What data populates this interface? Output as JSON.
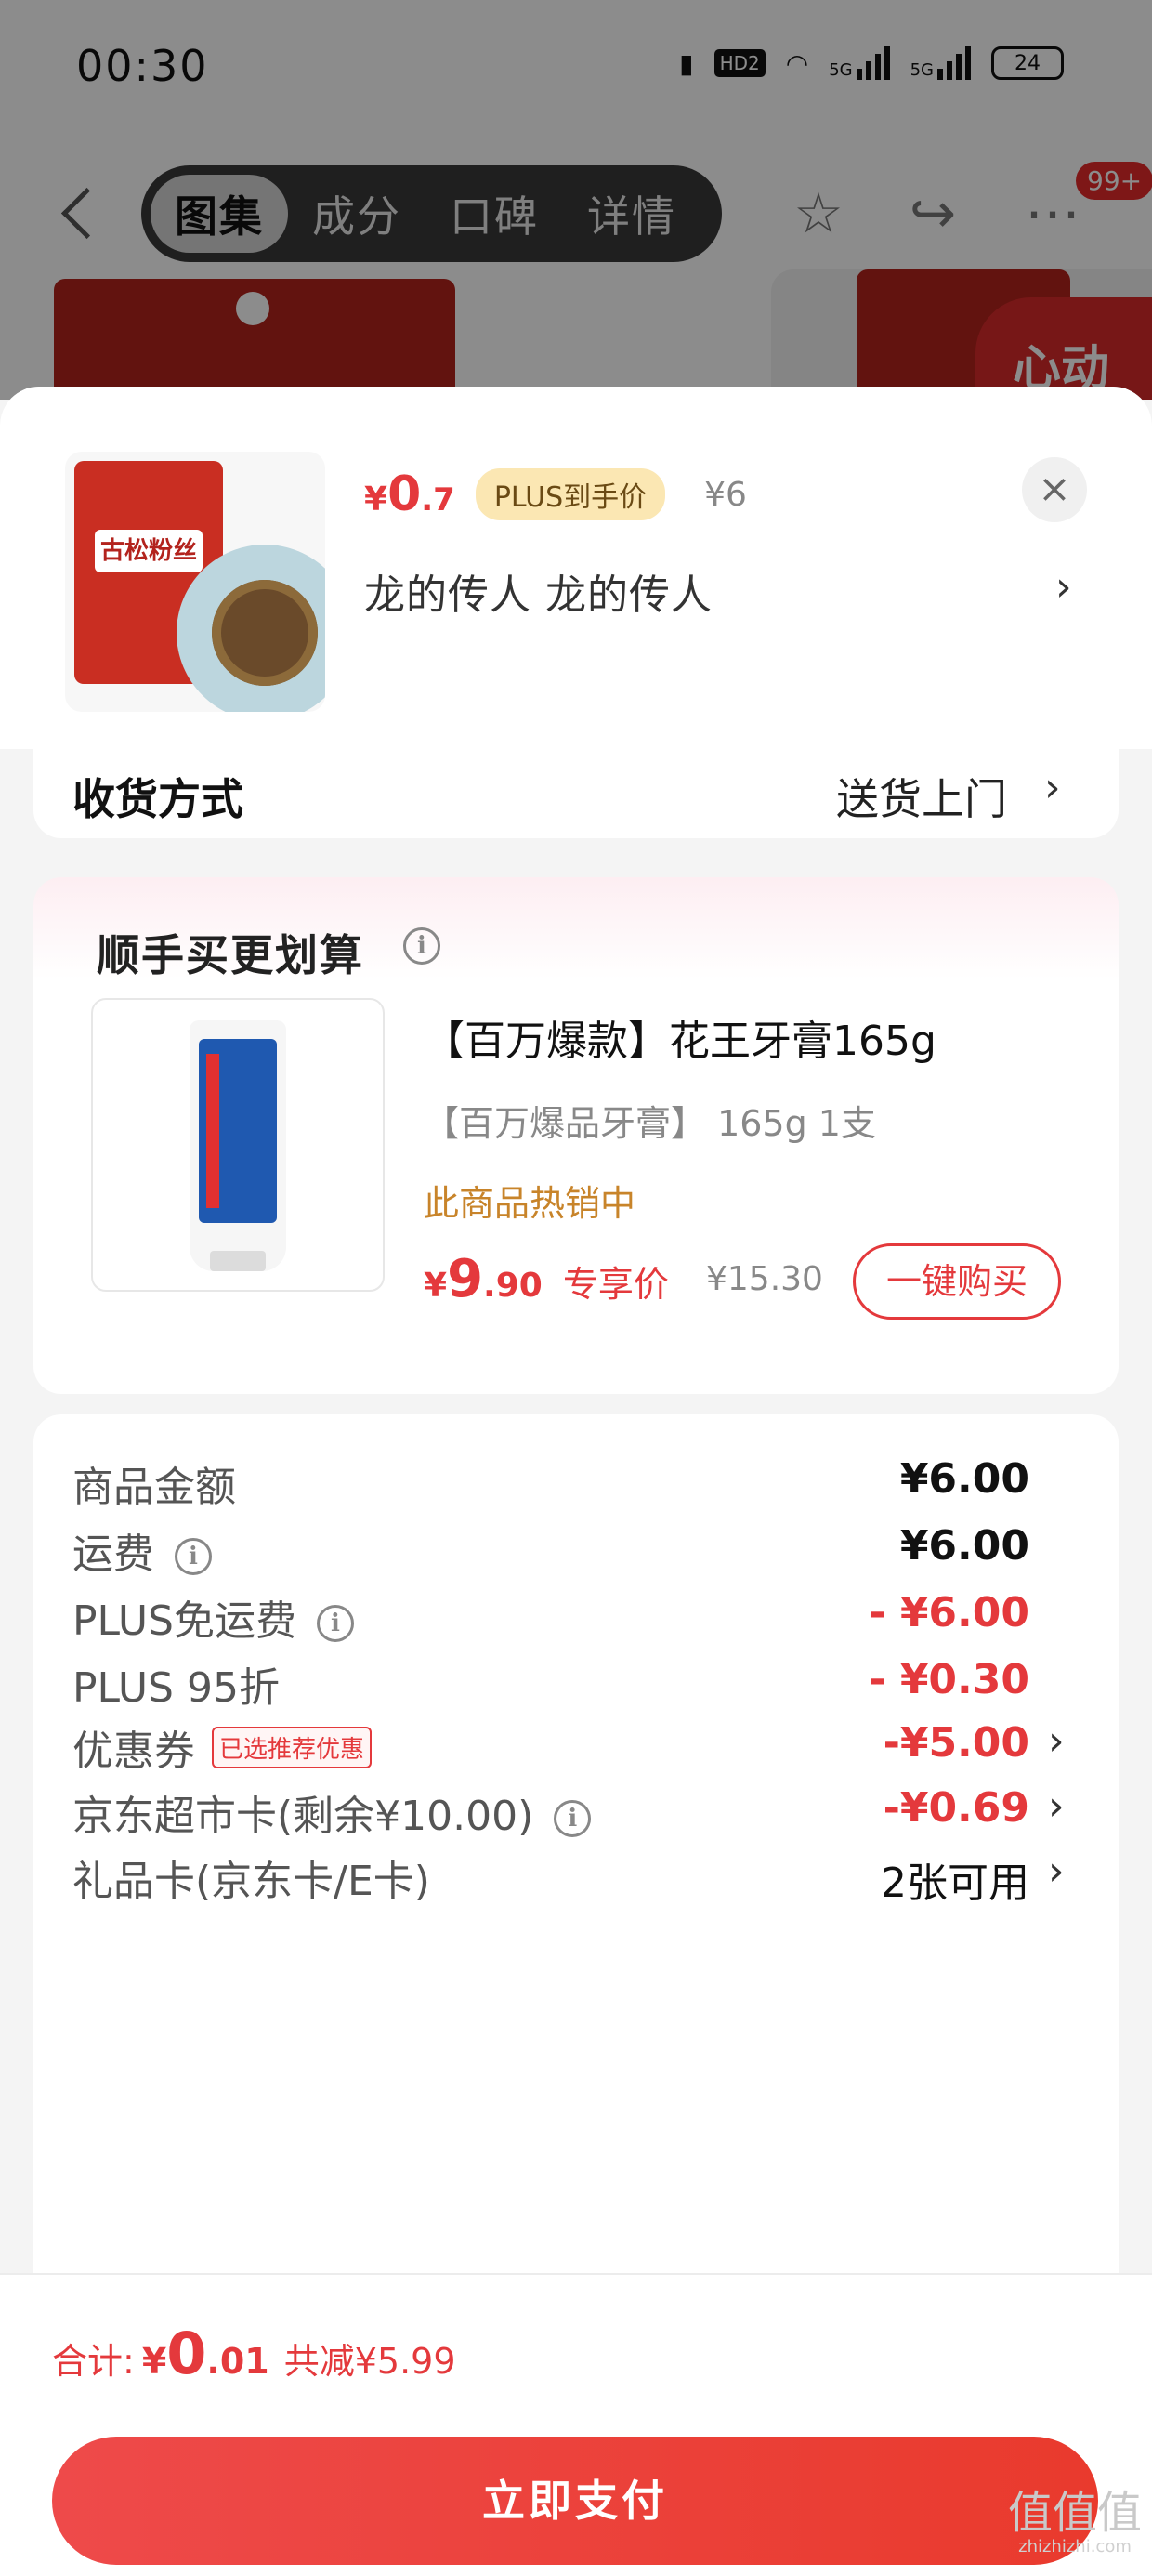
{
  "status_bar": {
    "time": "00:30",
    "hd_label": "HD2",
    "net1": "5G",
    "net2": "5G",
    "battery": "24"
  },
  "nav": {
    "tabs": [
      {
        "label": "图集",
        "active": true
      },
      {
        "label": "成分",
        "active": false
      },
      {
        "label": "口碑",
        "active": false
      },
      {
        "label": "详情",
        "active": false
      }
    ],
    "message_badge": "99+"
  },
  "gallery": {
    "banner_text": "心动"
  },
  "summary": {
    "price_currency": "¥",
    "price_int": "0",
    "price_dec": ".7",
    "plus_tag": "PLUS到手价",
    "original_price": "¥6",
    "spec": "龙的传人  龙的传人",
    "thumb_label": "古松粉丝"
  },
  "shipping": {
    "label": "收货方式",
    "value": "送货上门"
  },
  "upsell": {
    "title": "顺手买更划算",
    "product_title": "【百万爆款】花王牙膏165g",
    "product_spec": "【百万爆品牙膏】 165g 1支",
    "hot_text": "此商品热销中",
    "price_currency": "¥",
    "price_int": "9",
    "price_dec": ".90",
    "price_note": "专享价",
    "original_price": "¥15.30",
    "buy_button": "一键购买"
  },
  "totals": {
    "rows": [
      {
        "label": "商品金额",
        "value": "¥6.00"
      },
      {
        "label": "运费",
        "value": "¥6.00"
      },
      {
        "label": "PLUS免运费",
        "value": "- ¥6.00"
      },
      {
        "label": "PLUS 95折",
        "value": "- ¥0.30"
      },
      {
        "label": "优惠券",
        "tag": "已选推荐优惠",
        "value": "-¥5.00"
      },
      {
        "label": "京东超市卡(剩余¥10.00)",
        "value": "-¥0.69"
      },
      {
        "label": "礼品卡(京东卡/E卡)",
        "value": "2张可用"
      }
    ]
  },
  "footer": {
    "total_label": "合计:",
    "total_currency": "¥",
    "total_int": "0",
    "total_dec": ".01",
    "savings": "共减¥5.99",
    "pay_button": "立即支付",
    "watermark": "值值值",
    "watermark_sub": "zhizhizhi.com"
  },
  "colors": {
    "accent": "#e4393c",
    "plus_tag_bg": "#fbe7b3",
    "hot_text": "#c8842a"
  }
}
